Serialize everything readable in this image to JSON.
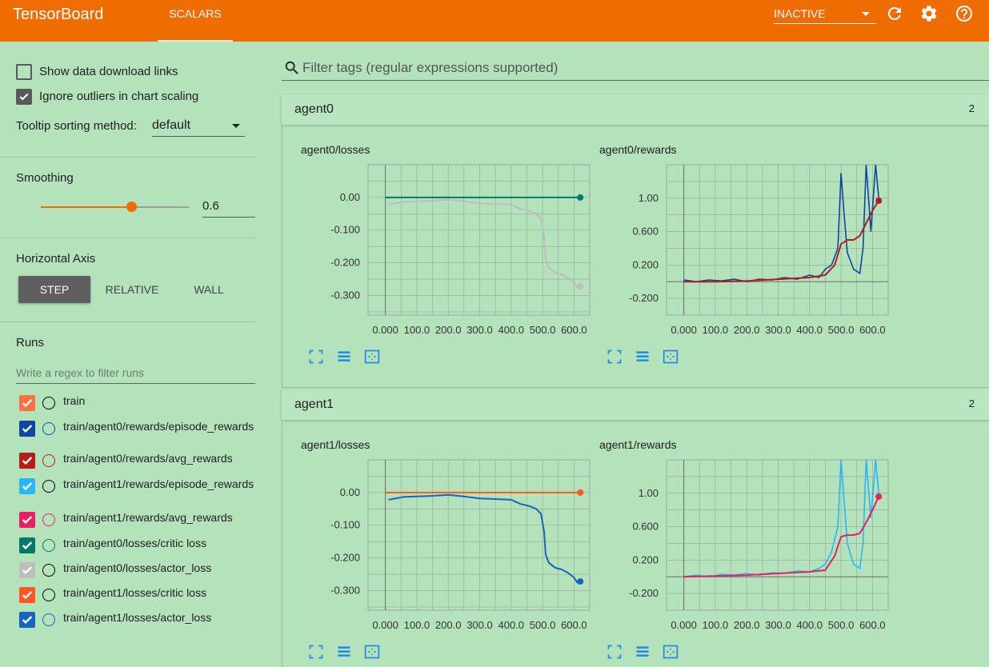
{
  "app": {
    "title": "TensorBoard",
    "tab": "SCALARS",
    "run_selector": "INACTIVE"
  },
  "sidebar": {
    "show_download_label": "Show data download links",
    "show_download_checked": false,
    "ignore_outliers_label": "Ignore outliers in chart scaling",
    "ignore_outliers_checked": true,
    "tooltip_sort_label": "Tooltip sorting method:",
    "tooltip_sort_value": "default",
    "smoothing_title": "Smoothing",
    "smoothing_value": "0.6",
    "smoothing_fraction": 0.6,
    "horizontal_axis_title": "Horizontal Axis",
    "axis_options": [
      "STEP",
      "RELATIVE",
      "WALL"
    ],
    "axis_selected": "STEP",
    "runs_title": "Runs",
    "runs_filter_placeholder": "Write a regex to filter runs",
    "runs": [
      {
        "name": "train",
        "color": "#ff7043"
      },
      {
        "name": "train/agent0/rewards/episode_rewards",
        "color": "#0d47a1"
      },
      {
        "name": "train/agent0/rewards/avg_rewards",
        "color": "#b71c1c"
      },
      {
        "name": "train/agent1/rewards/episode_rewards",
        "color": "#29b6f6"
      },
      {
        "name": "train/agent1/rewards/avg_rewards",
        "color": "#e91e63"
      },
      {
        "name": "train/agent0/losses/critic loss",
        "color": "#00796b"
      },
      {
        "name": "train/agent0/losses/actor_loss",
        "color": "#bdbdbd"
      },
      {
        "name": "train/agent1/losses/critic loss",
        "color": "#ff5722"
      },
      {
        "name": "train/agent1/losses/actor_loss",
        "color": "#1565c0"
      }
    ]
  },
  "main": {
    "filter_placeholder": "Filter tags (regular expressions supported)",
    "groups": [
      {
        "name": "agent0",
        "count": "2"
      },
      {
        "name": "agent1",
        "count": "2"
      }
    ]
  },
  "chart_data": [
    {
      "type": "line",
      "title": "agent0/losses",
      "x_ticks": [
        "0.000",
        "100.0",
        "200.0",
        "300.0",
        "400.0",
        "500.0",
        "600.0"
      ],
      "y_ticks": [
        {
          "v": 0,
          "label": "0.00"
        },
        {
          "v": -0.1,
          "label": "-0.100"
        },
        {
          "v": -0.2,
          "label": "-0.200"
        },
        {
          "v": -0.3,
          "label": "-0.300"
        }
      ],
      "xlim": [
        -55,
        650
      ],
      "ylim": [
        -0.36,
        0.1
      ],
      "series": [
        {
          "color": "#00796b",
          "points": [
            [
              0,
              0
            ],
            [
              620,
              0
            ]
          ]
        },
        {
          "color": "#bdbdbd",
          "points": [
            [
              10,
              -0.022
            ],
            [
              60,
              -0.013
            ],
            [
              100,
              -0.012
            ],
            [
              150,
              -0.01
            ],
            [
              200,
              -0.007
            ],
            [
              250,
              -0.012
            ],
            [
              300,
              -0.018
            ],
            [
              350,
              -0.02
            ],
            [
              400,
              -0.022
            ],
            [
              430,
              -0.035
            ],
            [
              460,
              -0.042
            ],
            [
              480,
              -0.05
            ],
            [
              495,
              -0.065
            ],
            [
              505,
              -0.12
            ],
            [
              510,
              -0.19
            ],
            [
              520,
              -0.215
            ],
            [
              540,
              -0.23
            ],
            [
              560,
              -0.235
            ],
            [
              580,
              -0.245
            ],
            [
              600,
              -0.26
            ],
            [
              610,
              -0.275
            ],
            [
              620,
              -0.272
            ]
          ]
        }
      ]
    },
    {
      "type": "line",
      "title": "agent0/rewards",
      "x_ticks": [
        "0.000",
        "100.0",
        "200.0",
        "300.0",
        "400.0",
        "500.0",
        "600.0"
      ],
      "y_ticks": [
        {
          "v": 1.0,
          "label": "1.00"
        },
        {
          "v": 0.6,
          "label": "0.600"
        },
        {
          "v": 0.2,
          "label": "0.200"
        },
        {
          "v": -0.2,
          "label": "-0.200"
        }
      ],
      "xlim": [
        -55,
        650
      ],
      "ylim": [
        -0.4,
        1.4
      ],
      "series": [
        {
          "color": "#0d47a1",
          "points": [
            [
              0,
              0.02
            ],
            [
              40,
              0.0
            ],
            [
              80,
              0.02
            ],
            [
              120,
              0.01
            ],
            [
              160,
              0.03
            ],
            [
              200,
              0.0
            ],
            [
              240,
              0.03
            ],
            [
              280,
              0.02
            ],
            [
              320,
              0.05
            ],
            [
              360,
              0.03
            ],
            [
              400,
              0.08
            ],
            [
              430,
              0.05
            ],
            [
              450,
              0.15
            ],
            [
              470,
              0.2
            ],
            [
              490,
              0.4
            ],
            [
              500,
              1.3
            ],
            [
              510,
              0.8
            ],
            [
              520,
              0.35
            ],
            [
              540,
              0.15
            ],
            [
              560,
              0.1
            ],
            [
              570,
              0.4
            ],
            [
              580,
              1.4
            ],
            [
              595,
              0.6
            ],
            [
              610,
              1.4
            ],
            [
              620,
              1.0
            ]
          ]
        },
        {
          "color": "#b71c1c",
          "points": [
            [
              0,
              0.0
            ],
            [
              100,
              0.0
            ],
            [
              200,
              0.01
            ],
            [
              300,
              0.03
            ],
            [
              400,
              0.05
            ],
            [
              450,
              0.08
            ],
            [
              480,
              0.2
            ],
            [
              500,
              0.45
            ],
            [
              520,
              0.5
            ],
            [
              540,
              0.5
            ],
            [
              560,
              0.55
            ],
            [
              580,
              0.7
            ],
            [
              600,
              0.85
            ],
            [
              620,
              0.97
            ]
          ]
        }
      ]
    },
    {
      "type": "line",
      "title": "agent1/losses",
      "x_ticks": [
        "0.000",
        "100.0",
        "200.0",
        "300.0",
        "400.0",
        "500.0",
        "600.0"
      ],
      "y_ticks": [
        {
          "v": 0,
          "label": "0.00"
        },
        {
          "v": -0.1,
          "label": "-0.100"
        },
        {
          "v": -0.2,
          "label": "-0.200"
        },
        {
          "v": -0.3,
          "label": "-0.300"
        }
      ],
      "xlim": [
        -55,
        650
      ],
      "ylim": [
        -0.36,
        0.1
      ],
      "series": [
        {
          "color": "#ff5722",
          "points": [
            [
              0,
              0
            ],
            [
              620,
              0
            ]
          ]
        },
        {
          "color": "#1565c0",
          "points": [
            [
              10,
              -0.022
            ],
            [
              60,
              -0.013
            ],
            [
              100,
              -0.012
            ],
            [
              150,
              -0.01
            ],
            [
              200,
              -0.007
            ],
            [
              250,
              -0.012
            ],
            [
              300,
              -0.018
            ],
            [
              350,
              -0.02
            ],
            [
              400,
              -0.022
            ],
            [
              430,
              -0.035
            ],
            [
              460,
              -0.042
            ],
            [
              480,
              -0.05
            ],
            [
              495,
              -0.065
            ],
            [
              505,
              -0.12
            ],
            [
              510,
              -0.19
            ],
            [
              520,
              -0.215
            ],
            [
              540,
              -0.23
            ],
            [
              560,
              -0.235
            ],
            [
              580,
              -0.245
            ],
            [
              600,
              -0.26
            ],
            [
              610,
              -0.275
            ],
            [
              620,
              -0.272
            ]
          ]
        }
      ]
    },
    {
      "type": "line",
      "title": "agent1/rewards",
      "x_ticks": [
        "0.000",
        "100.0",
        "200.0",
        "300.0",
        "400.0",
        "500.0",
        "600.0"
      ],
      "y_ticks": [
        {
          "v": 1.0,
          "label": "1.00"
        },
        {
          "v": 0.6,
          "label": "0.600"
        },
        {
          "v": 0.2,
          "label": "0.200"
        },
        {
          "v": -0.2,
          "label": "-0.200"
        }
      ],
      "xlim": [
        -55,
        650
      ],
      "ylim": [
        -0.4,
        1.4
      ],
      "series": [
        {
          "color": "#29b6f6",
          "points": [
            [
              0,
              0.0
            ],
            [
              40,
              0.02
            ],
            [
              80,
              0.0
            ],
            [
              120,
              0.03
            ],
            [
              160,
              0.02
            ],
            [
              200,
              0.04
            ],
            [
              240,
              0.02
            ],
            [
              280,
              0.05
            ],
            [
              320,
              0.04
            ],
            [
              360,
              0.07
            ],
            [
              400,
              0.06
            ],
            [
              430,
              0.1
            ],
            [
              450,
              0.15
            ],
            [
              470,
              0.3
            ],
            [
              490,
              0.6
            ],
            [
              500,
              1.4
            ],
            [
              510,
              0.9
            ],
            [
              520,
              0.4
            ],
            [
              540,
              0.15
            ],
            [
              560,
              0.1
            ],
            [
              570,
              0.4
            ],
            [
              580,
              1.4
            ],
            [
              595,
              0.7
            ],
            [
              610,
              1.4
            ],
            [
              620,
              1.0
            ]
          ]
        },
        {
          "color": "#e91e63",
          "points": [
            [
              0,
              0.0
            ],
            [
              100,
              0.01
            ],
            [
              200,
              0.02
            ],
            [
              300,
              0.04
            ],
            [
              400,
              0.06
            ],
            [
              450,
              0.08
            ],
            [
              480,
              0.25
            ],
            [
              500,
              0.48
            ],
            [
              520,
              0.5
            ],
            [
              540,
              0.5
            ],
            [
              560,
              0.52
            ],
            [
              580,
              0.65
            ],
            [
              600,
              0.8
            ],
            [
              620,
              0.96
            ]
          ]
        }
      ]
    }
  ]
}
